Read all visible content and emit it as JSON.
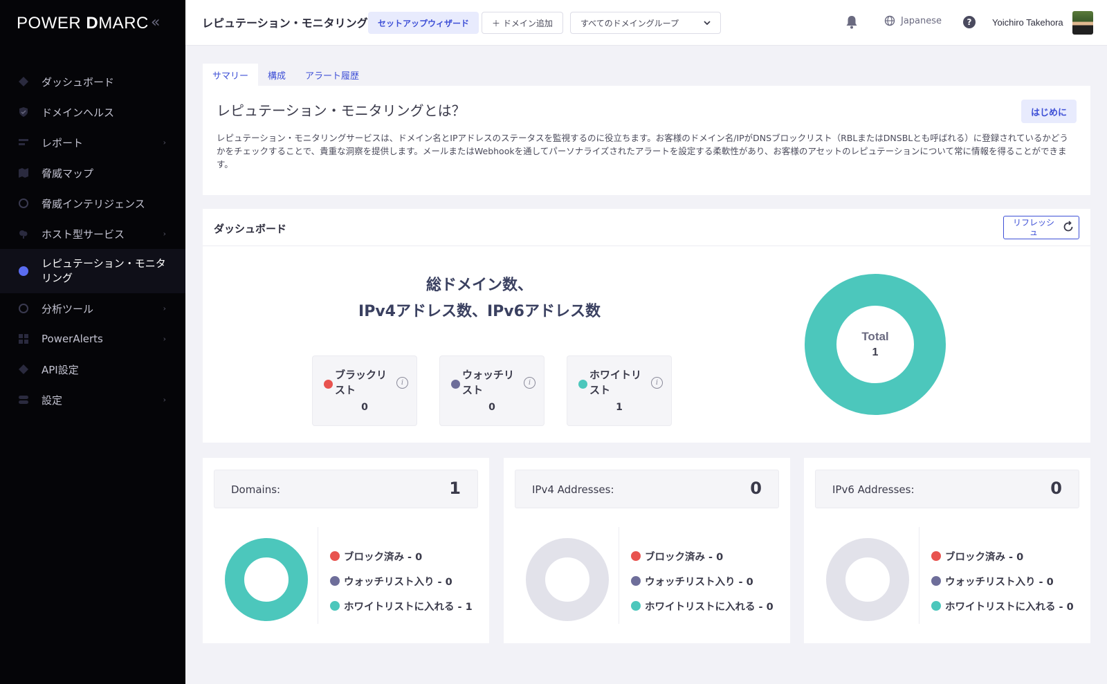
{
  "colors": {
    "teal": "#4cc7bc",
    "red": "#e8534f",
    "slate": "#6e6e9a",
    "gray": "#e2e2ea",
    "accent": "#3d4fd6"
  },
  "sidebar": {
    "logo_pre": "POW",
    "logo_e": "ER",
    "logo_d": "D",
    "logo_post": "MARC",
    "collapse_icon": "double-chevron-left-icon",
    "items": [
      {
        "label": "ダッシュボード",
        "icon": "diamond-icon",
        "chevron": false
      },
      {
        "label": "ドメインヘルス",
        "icon": "shield-check-icon",
        "chevron": false
      },
      {
        "label": "レポート",
        "icon": "report-icon",
        "chevron": true
      },
      {
        "label": "脅威マップ",
        "icon": "map-icon",
        "chevron": false
      },
      {
        "label": "脅威インテリジェンス",
        "icon": "circle-icon",
        "chevron": false
      },
      {
        "label": "ホスト型サービス",
        "icon": "cloud-icon",
        "chevron": true
      },
      {
        "label": "レピュテーション・モニタリング",
        "icon": "badge-icon",
        "chevron": false,
        "active": true
      },
      {
        "label": "分析ツール",
        "icon": "circle-icon",
        "chevron": true
      },
      {
        "label": "PowerAlerts",
        "icon": "grid-icon",
        "chevron": true
      },
      {
        "label": "API設定",
        "icon": "diamond-icon",
        "chevron": false
      },
      {
        "label": "設定",
        "icon": "toggle-icon",
        "chevron": true
      }
    ]
  },
  "topbar": {
    "title": "レピュテーション・モニタリング",
    "wizard_label": "セットアップウィザード",
    "add_domain_label": "＋ ドメイン追加",
    "group_select": "すべてのドメイングループ",
    "language": "Japanese",
    "help": "?",
    "user_name": "Yoichiro Takehora"
  },
  "tabs": [
    "サマリー",
    "構成",
    "アラート履歴"
  ],
  "intro": {
    "title": "レピュテーション・モニタリングとは？",
    "start_label": "はじめに",
    "body": "レピュテーション・モニタリングサービスは、ドメイン名とIPアドレスのステータスを監視するのに役立ちます。お客様のドメイン名/IPがDNSブロックリスト（RBLまたはDNSBLとも呼ばれる）に登録されているかどうかをチェックすることで、貴重な洞察を提供します。メールまたはWebhookを通してパーソナライズされたアラートを設定する柔軟性があり、お客様のアセットのレピュテーションについて常に情報を得ることができます。"
  },
  "dashboard": {
    "title": "ダッシュボード",
    "refresh_label": "リフレッシュ",
    "heading_line1": "総ドメイン数、",
    "heading_line2": "IPv4アドレス数、IPv6アドレス数",
    "stats": [
      {
        "label": "ブラックリスト",
        "value": "0",
        "color": "#e8534f"
      },
      {
        "label": "ウォッチリスト",
        "value": "0",
        "color": "#6e6e9a"
      },
      {
        "label": "ホワイトリスト",
        "value": "1",
        "color": "#4cc7bc"
      }
    ],
    "total_label": "Total",
    "total_value": "1"
  },
  "cards": [
    {
      "label": "Domains:",
      "value": "1",
      "legend": [
        "ブロック済み - 0",
        "ウォッチリスト入り - 0",
        "ホワイトリストに入れる - 1"
      ],
      "whitelist_share": 1
    },
    {
      "label": "IPv4 Addresses:",
      "value": "0",
      "legend": [
        "ブロック済み - 0",
        "ウォッチリスト入り - 0",
        "ホワイトリストに入れる - 0"
      ],
      "whitelist_share": 0
    },
    {
      "label": "IPv6 Addresses:",
      "value": "0",
      "legend": [
        "ブロック済み - 0",
        "ウォッチリスト入り - 0",
        "ホワイトリストに入れる - 0"
      ],
      "whitelist_share": 0
    }
  ]
}
